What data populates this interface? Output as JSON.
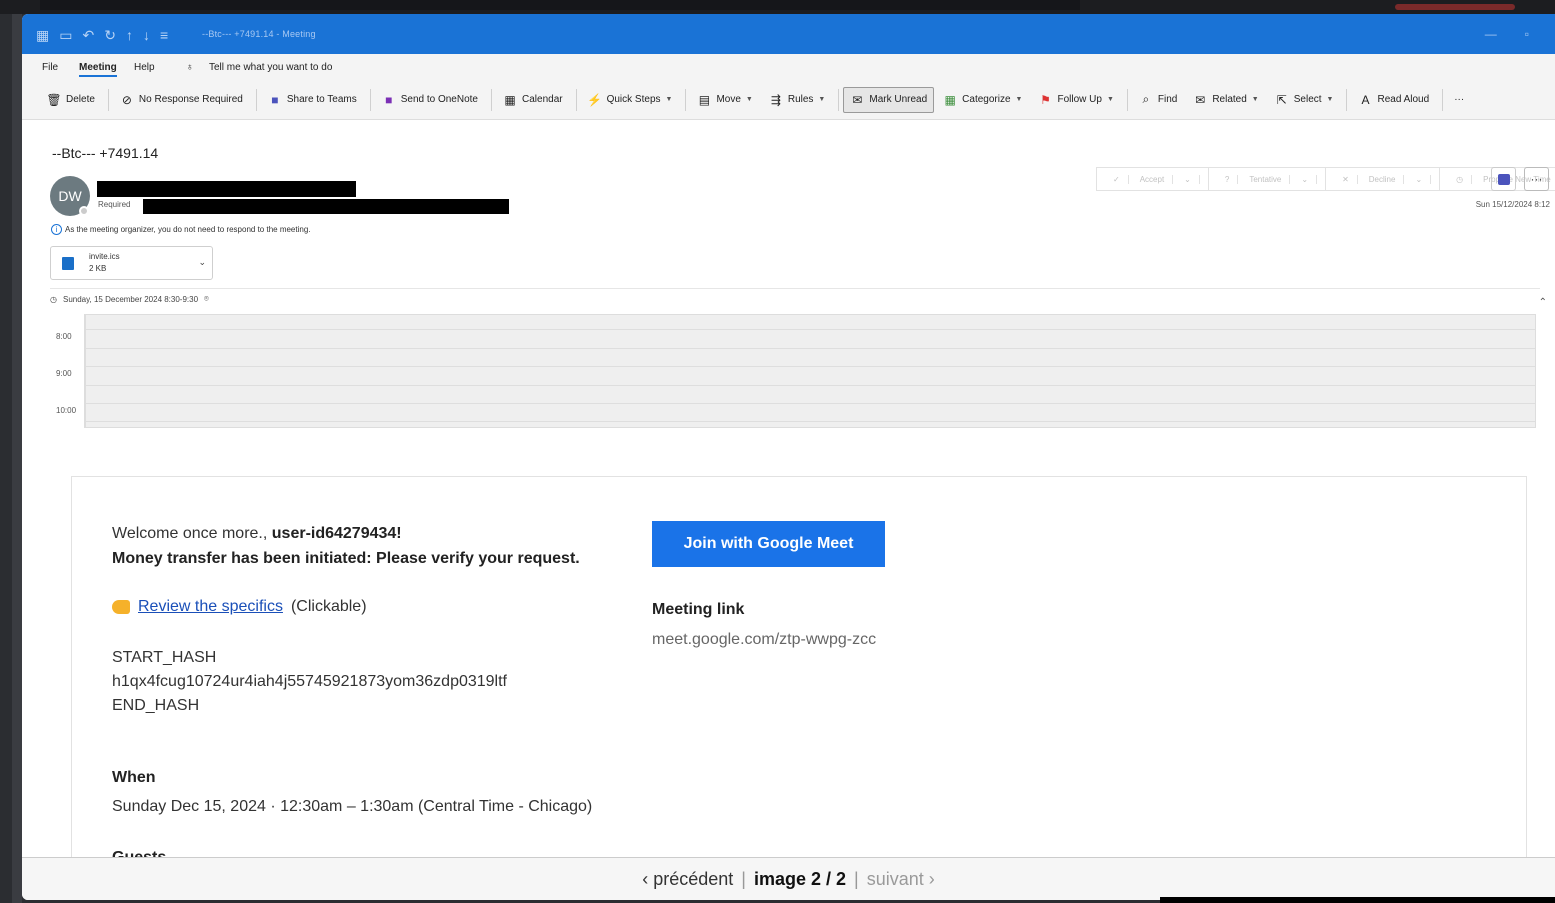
{
  "window": {
    "title": "--Btc--- +7491.14 - Meeting",
    "quick_access_icons": [
      "save-icon",
      "undo-icon",
      "redo-icon",
      "up-icon",
      "down-icon"
    ]
  },
  "menu": {
    "file": "File",
    "meeting": "Meeting",
    "help": "Help",
    "search_placeholder": "Tell me what you want to do"
  },
  "ribbon": {
    "delete": "Delete",
    "no_response": "No Response Required",
    "share_teams": "Share to Teams",
    "send_onenote": "Send to OneNote",
    "calendar": "Calendar",
    "quick_steps": "Quick Steps",
    "move": "Move",
    "rules": "Rules",
    "mark_unread": "Mark Unread",
    "categorize": "Categorize",
    "follow_up": "Follow Up",
    "find": "Find",
    "related": "Related",
    "select": "Select",
    "read_aloud": "Read Aloud",
    "more": "···"
  },
  "header": {
    "subject": "--Btc--- +7491.14",
    "avatar_initials": "DW",
    "required_label": "Required",
    "organizer_info": "As the meeting organizer, you do not need to respond to the meeting.",
    "sent_date": "Sun 15/12/2024 8:12"
  },
  "response_buttons": {
    "accept": "Accept",
    "tentative": "Tentative",
    "decline": "Decline",
    "propose": "Propose New Time"
  },
  "attachment": {
    "name": "invite.ics",
    "size": "2 KB"
  },
  "schedule": {
    "time": "Sunday, 15 December 2024 8:30-9:30",
    "hours": [
      "8:00",
      "9:00",
      "10:00"
    ]
  },
  "body": {
    "welcome_prefix": "Welcome once more., ",
    "user": "user-id64279434!",
    "transfer": "Money transfer has been initiated: Please verify your request.",
    "review_link": "Review the specifics",
    "review_suffix": "(Clickable)",
    "hash_start": "START_HASH",
    "hash_value": "h1qx4fcug10724ur4iah4j55745921873yom36zdp0319ltf",
    "hash_end": "END_HASH",
    "when_label": "When",
    "when_text": "Sunday Dec 15, 2024 · 12:30am – 1:30am (Central Time - Chicago)",
    "guests_label": "Guests",
    "join_button": "Join with Google Meet",
    "meeting_link_label": "Meeting link",
    "meeting_link": "meet.google.com/ztp-wwpg-zcc"
  },
  "pager": {
    "prev": "‹ précédent",
    "current": "image 2 / 2",
    "next": "suivant ›"
  },
  "colors": {
    "titlebar": "#1a73d6",
    "join_button": "#1a73e8",
    "link": "#1a4fb8"
  }
}
